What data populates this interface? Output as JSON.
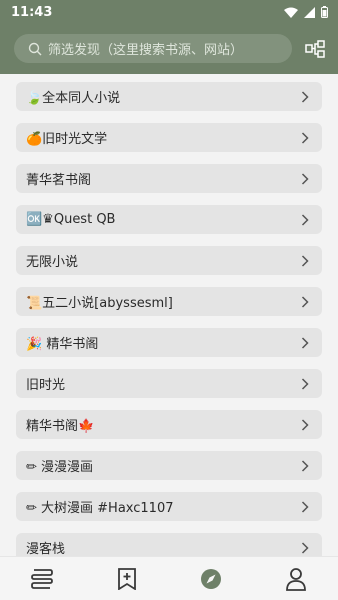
{
  "status_bar": {
    "time": "11:43"
  },
  "search": {
    "placeholder": "筛选发现（这里搜索书源、网站）"
  },
  "header": {
    "group_icon": "group-icon"
  },
  "items": [
    {
      "label": "🍃全本同人小说"
    },
    {
      "label": "🍊旧时光文学"
    },
    {
      "label": "菁华茗书阁"
    },
    {
      "label": "🆗♛Quest QB"
    },
    {
      "label": "无限小说"
    },
    {
      "label": "📜五二小说[abyssesml]"
    },
    {
      "label": "🎉 精华书阁"
    },
    {
      "label": "旧时光"
    },
    {
      "label": "精华书阁🍁"
    },
    {
      "label": "✏ 漫漫漫画"
    },
    {
      "label": "✏ 大树漫画 #Haxc1107"
    },
    {
      "label": "漫客栈"
    }
  ],
  "bottom_nav": [
    {
      "icon": "bookshelf-icon"
    },
    {
      "icon": "bookmark-add-icon"
    },
    {
      "icon": "compass-icon",
      "active": true
    },
    {
      "icon": "profile-icon"
    }
  ],
  "colors": {
    "header_bg": "#6e8068",
    "item_bg": "#e4e4e4",
    "page_bg": "#f3f3f3",
    "active_nav": "#6e8068"
  }
}
